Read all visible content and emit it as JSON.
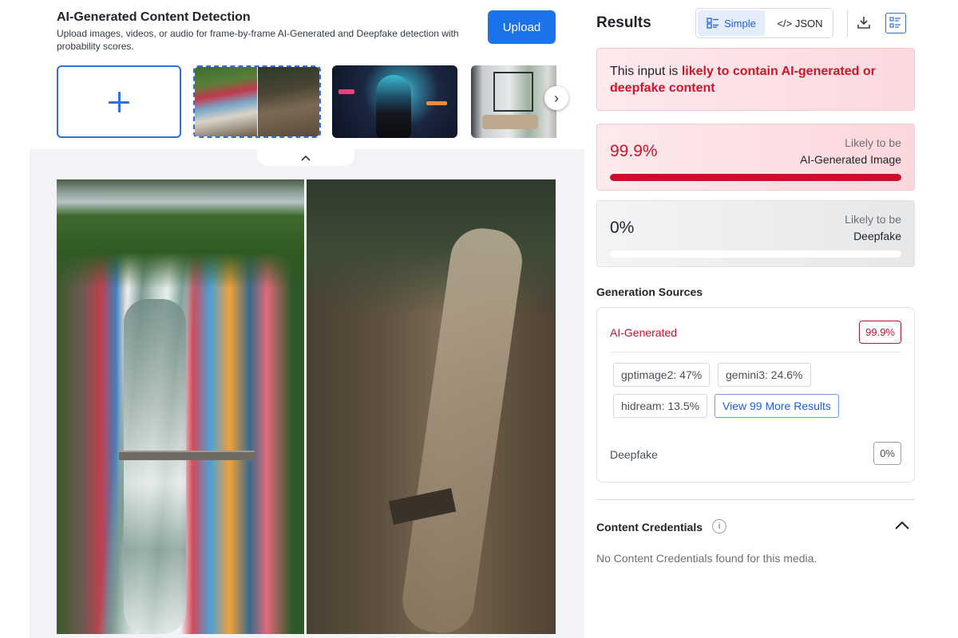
{
  "header": {
    "title": "AI-Generated Content Detection",
    "subtitle": "Upload images, videos, or audio for frame-by-frame AI-Generated and Deepfake detection with probability scores.",
    "upload_label": "Upload"
  },
  "thumbnails": {
    "add_icon": "plus-icon",
    "next_icon": "chevron-right-icon",
    "next_glyph": "›",
    "collapse_glyph": "⌃"
  },
  "results": {
    "title": "Results",
    "toggle": {
      "simple_label": "Simple",
      "json_label": "</> JSON",
      "selected": "Simple"
    },
    "verdict": {
      "prefix": "This input is ",
      "highlight": "likely to contain AI-generated or deepfake content"
    },
    "scores": {
      "ai": {
        "value": "99.9%",
        "fill": 0.999,
        "label_top": "Likely to be",
        "label_bottom": "AI-Generated Image"
      },
      "deepfake": {
        "value": "0%",
        "fill": 0.0,
        "label_top": "Likely to be",
        "label_bottom": "Deepfake"
      }
    },
    "generation_sources": {
      "title": "Generation Sources",
      "ai_label": "AI-Generated",
      "ai_value": "99.9%",
      "chips": [
        "gptimage2: 47%",
        "gemini3: 24.6%",
        "hidream: 13.5%"
      ],
      "more_label": "View 99 More Results",
      "deepfake_label": "Deepfake",
      "deepfake_value": "0%"
    },
    "content_credentials": {
      "title": "Content Credentials",
      "info_glyph": "i",
      "message": "No Content Credentials found for this media."
    }
  },
  "colors": {
    "accent": "#1a73e8",
    "danger": "#c8102e",
    "danger_bg": "#fde9ec"
  }
}
